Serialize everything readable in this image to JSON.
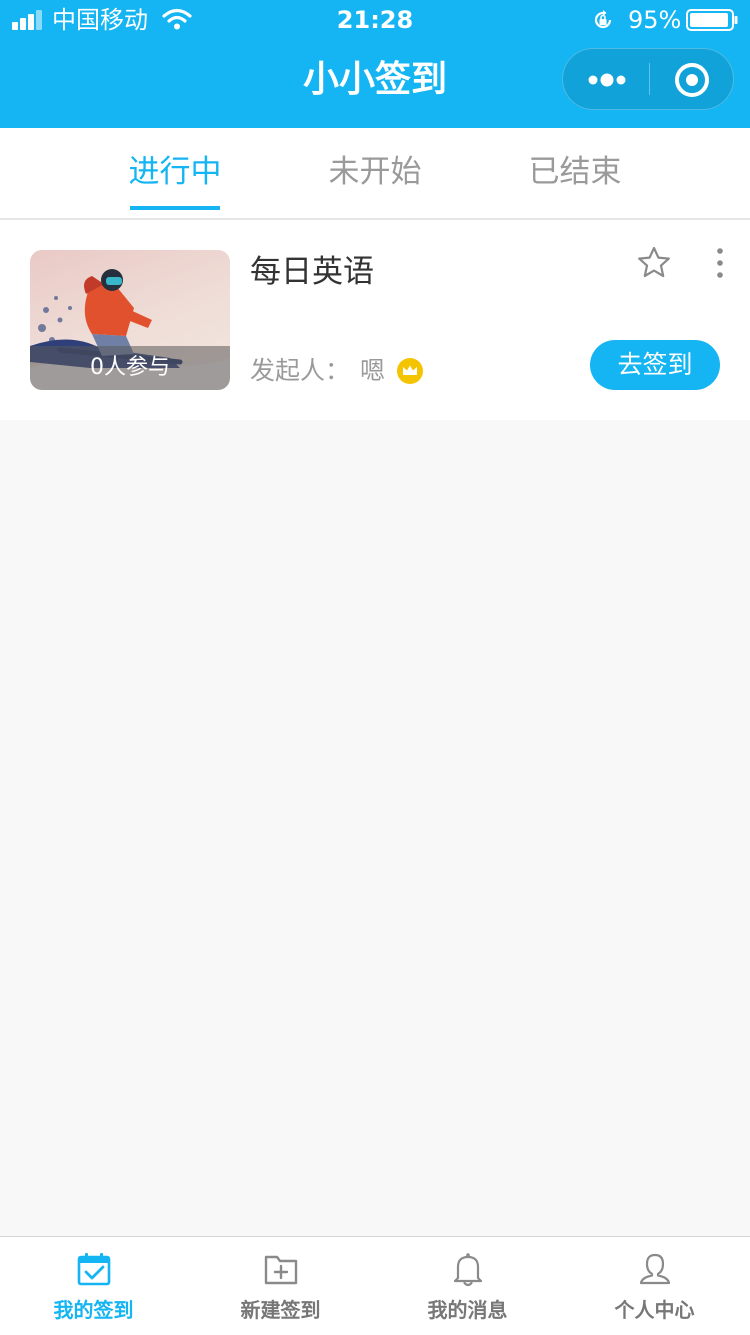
{
  "status_bar": {
    "carrier": "中国移动",
    "time": "21:28",
    "battery": "95%",
    "signal_bars": 4,
    "battery_level": 0.95
  },
  "nav": {
    "title": "小小签到",
    "more_icon": "more-dots-icon",
    "close_icon": "target-close-icon"
  },
  "tabs": [
    {
      "label": "进行中",
      "active": true
    },
    {
      "label": "未开始",
      "active": false
    },
    {
      "label": "已结束",
      "active": false
    }
  ],
  "activities": [
    {
      "title": "每日英语",
      "participants": "0人参与",
      "initiator_label": "发起人：",
      "initiator_name": "嗯",
      "action": "去签到",
      "image": "snowboarder-photo",
      "favorite_icon": "star-outline-icon",
      "menu_icon": "more-vertical-icon",
      "badge_icon": "crown-icon"
    }
  ],
  "tabbar": [
    {
      "label": "我的签到",
      "icon": "calendar-check-icon",
      "active": true
    },
    {
      "label": "新建签到",
      "icon": "folder-plus-icon",
      "active": false
    },
    {
      "label": "我的消息",
      "icon": "bell-icon",
      "active": false
    },
    {
      "label": "个人中心",
      "icon": "user-icon",
      "active": false
    }
  ],
  "colors": {
    "accent": "#14b5f2",
    "background": "#f8f8f8",
    "crown": "#f5c400"
  }
}
